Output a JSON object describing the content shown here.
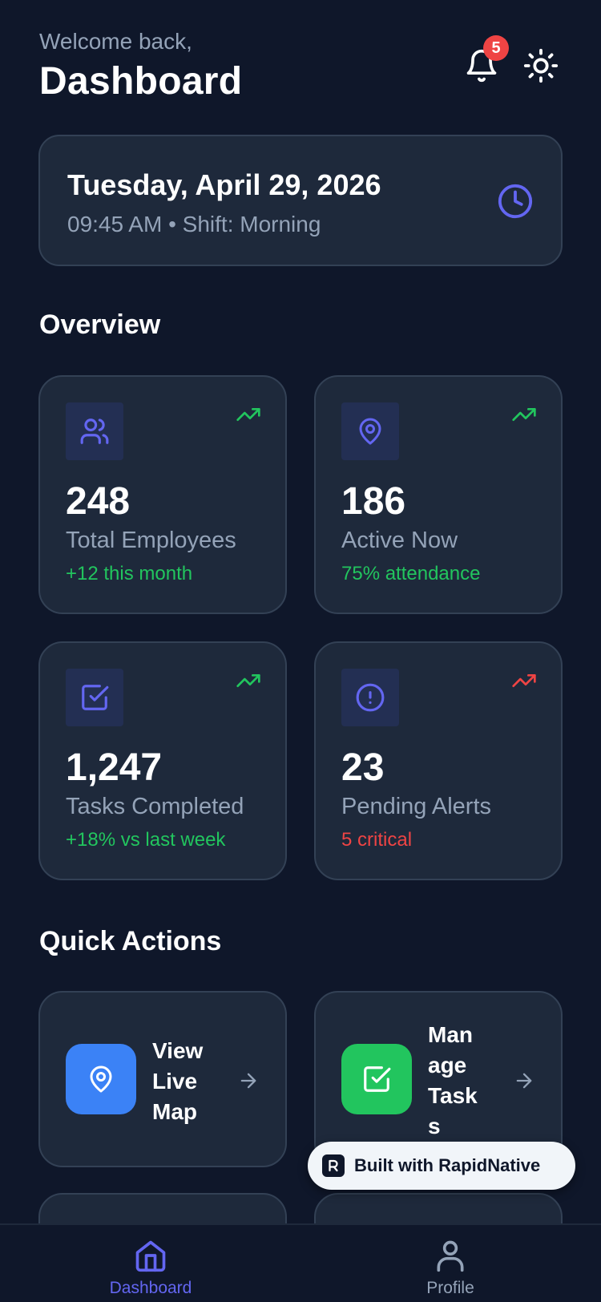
{
  "header": {
    "welcome": "Welcome back,",
    "title": "Dashboard",
    "notification_count": "5",
    "icons": [
      "bell-icon",
      "sun-icon"
    ]
  },
  "date_card": {
    "date": "Tuesday, April 29, 2026",
    "time_shift": "09:45 AM • Shift: Morning",
    "icon": "clock-icon"
  },
  "overview": {
    "title": "Overview",
    "stats": [
      {
        "value": "248",
        "label": "Total Employees",
        "sub": "+12 this month",
        "icon": "users-icon",
        "trend": "up"
      },
      {
        "value": "186",
        "label": "Active Now",
        "sub": "75% attendance",
        "icon": "map-pin-icon",
        "trend": "up"
      },
      {
        "value": "1,247",
        "label": "Tasks Completed",
        "sub": "+18% vs last week",
        "icon": "check-square-icon",
        "trend": "up"
      },
      {
        "value": "23",
        "label": "Pending Alerts",
        "sub": "5 critical",
        "icon": "alert-circle-icon",
        "trend": "up"
      }
    ]
  },
  "quick_actions": {
    "title": "Quick Actions",
    "items": [
      {
        "line1": "View",
        "line2": "Live",
        "line3": "Map",
        "icon": "map-pin-icon",
        "color": "#3b82f6"
      },
      {
        "line1": "Man",
        "line2": "age",
        "line3": "Task",
        "line4": "s",
        "icon": "check-square-icon",
        "color": "#22c55e"
      }
    ]
  },
  "built_with": "Built with RapidNative",
  "nav": {
    "items": [
      {
        "label": "Dashboard",
        "icon": "home-icon",
        "active": true
      },
      {
        "label": "Profile",
        "icon": "user-icon",
        "active": false
      }
    ]
  },
  "colors": {
    "background": "#0f172a",
    "card": "#1e293b",
    "accent": "#6366f1",
    "positive": "#22c55e",
    "negative": "#ef4444"
  }
}
